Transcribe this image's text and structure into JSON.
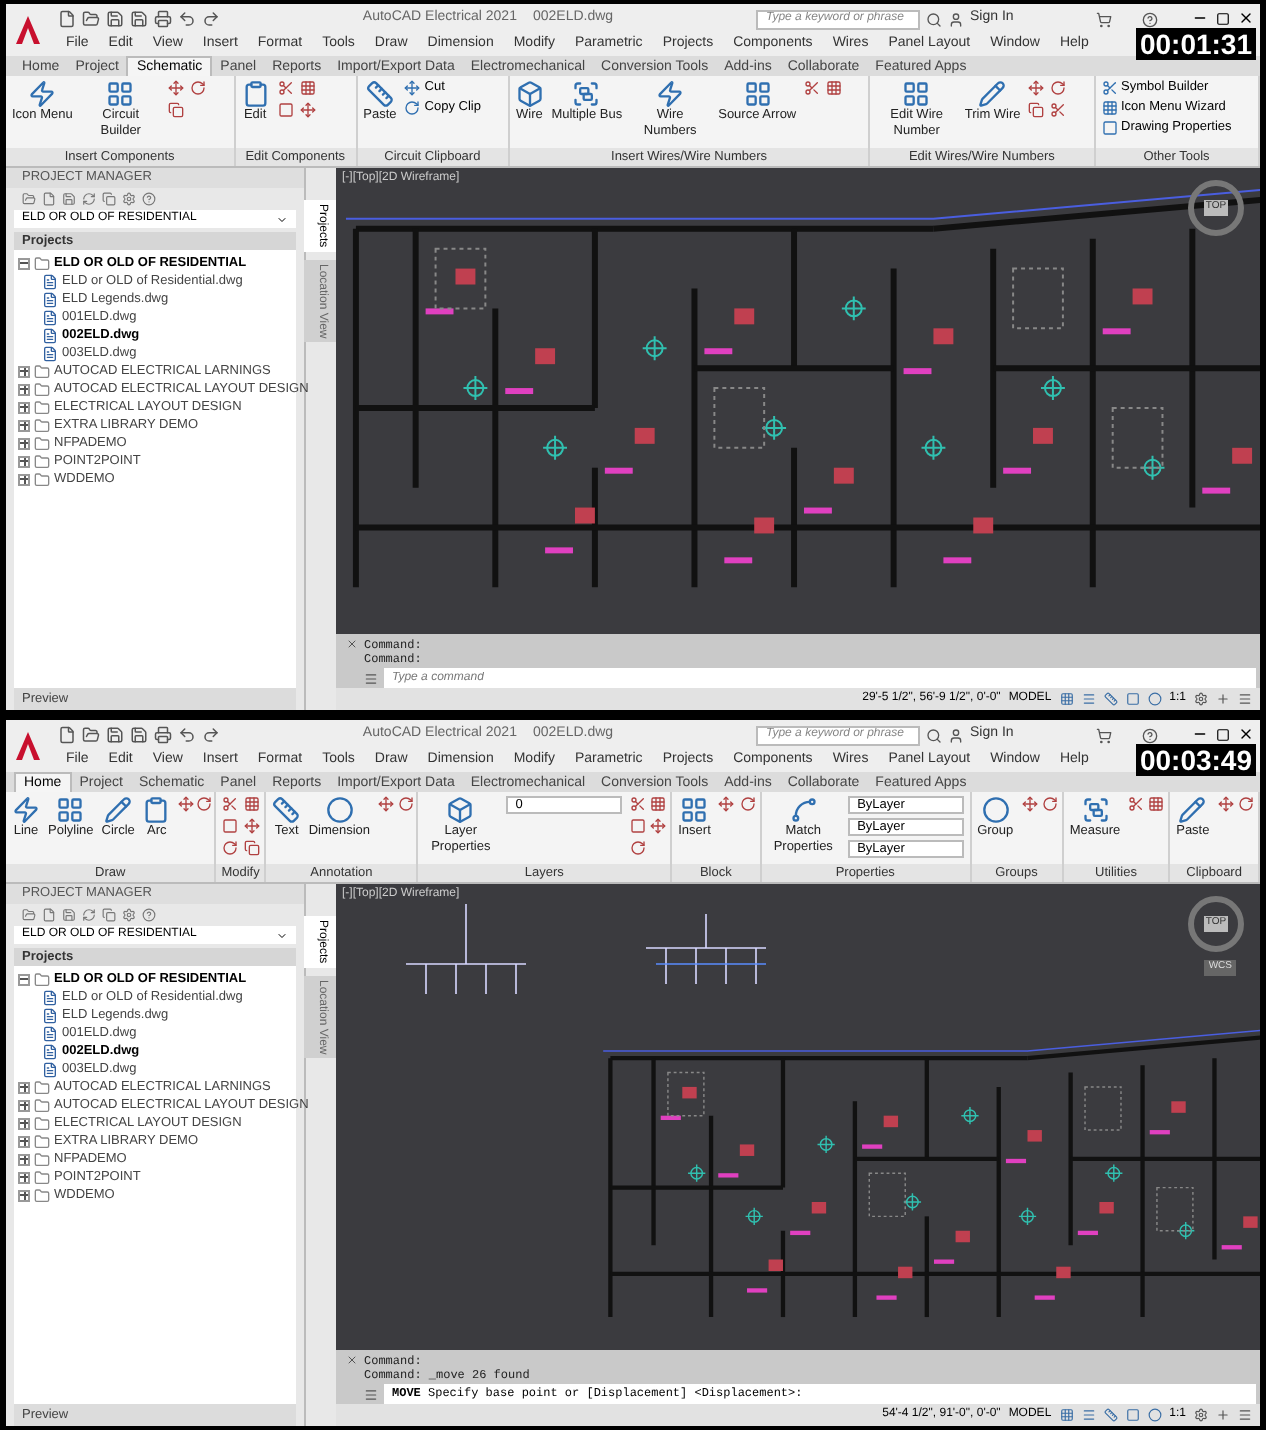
{
  "frames": [
    {
      "timestamp": "00:01:31",
      "title": {
        "app": "AutoCAD Electrical 2021",
        "file": "002ELD.dwg"
      },
      "search": {
        "placeholder": "Type a keyword or phrase"
      },
      "sign_in": "Sign In",
      "menu": [
        "File",
        "Edit",
        "View",
        "Insert",
        "Format",
        "Tools",
        "Draw",
        "Dimension",
        "Modify",
        "Parametric",
        "Projects",
        "Components",
        "Wires",
        "Panel Layout",
        "Window",
        "Help"
      ],
      "tabs": [
        {
          "label": "Home",
          "selected": false
        },
        {
          "label": "Project",
          "selected": false
        },
        {
          "label": "Schematic",
          "selected": true
        },
        {
          "label": "Panel",
          "selected": false
        },
        {
          "label": "Reports",
          "selected": false
        },
        {
          "label": "Import/Export Data",
          "selected": false
        },
        {
          "label": "Electromechanical",
          "selected": false
        },
        {
          "label": "Conversion Tools",
          "selected": false
        },
        {
          "label": "Add-ins",
          "selected": false
        },
        {
          "label": "Collaborate",
          "selected": false
        },
        {
          "label": "Featured Apps",
          "selected": false
        }
      ],
      "ribbon": [
        {
          "title": "Insert Components",
          "tools": [
            "Icon Menu",
            "Circuit Builder"
          ]
        },
        {
          "title": "Edit Components",
          "tools": [
            "Edit"
          ]
        },
        {
          "title": "Circuit Clipboard",
          "tools": [
            "Paste"
          ],
          "side": [
            "Cut",
            "Copy Clip"
          ]
        },
        {
          "title": "Insert Wires/Wire Numbers",
          "tools": [
            "Wire",
            "Multiple Bus",
            "Wire Numbers",
            "Source Arrow"
          ]
        },
        {
          "title": "Edit Wires/Wire Numbers",
          "tools": [
            "Edit Wire Number",
            "Trim Wire"
          ]
        },
        {
          "title": "Other Tools",
          "side": [
            "Symbol Builder",
            "Icon Menu  Wizard",
            "Drawing  Properties"
          ]
        }
      ],
      "project_manager": {
        "title": "PROJECT MANAGER",
        "selector": "ELD OR OLD OF RESIDENTIAL",
        "header": "Projects",
        "preview": "Preview",
        "side_tabs": [
          "Projects",
          "Location View"
        ],
        "tree": [
          {
            "label": "ELD OR OLD OF RESIDENTIAL",
            "selected": true,
            "expanded": true,
            "children": [
              {
                "label": "ELD or OLD of Residential.dwg",
                "selected": false
              },
              {
                "label": "ELD Legends.dwg",
                "selected": false
              },
              {
                "label": "001ELD.dwg",
                "selected": false
              },
              {
                "label": "002ELD.dwg",
                "selected": true
              },
              {
                "label": "003ELD.dwg",
                "selected": false
              }
            ]
          },
          {
            "label": "AUTOCAD ELECTRICAL LARNINGS",
            "selected": false,
            "expanded": false
          },
          {
            "label": "AUTOCAD ELECTRICAL LAYOUT DESIGN",
            "selected": false,
            "expanded": false
          },
          {
            "label": "ELECTRICAL LAYOUT DESIGN",
            "selected": false,
            "expanded": false
          },
          {
            "label": "EXTRA LIBRARY DEMO",
            "selected": false,
            "expanded": false
          },
          {
            "label": "NFPADEMO",
            "selected": false,
            "expanded": false
          },
          {
            "label": "POINT2POINT",
            "selected": false,
            "expanded": false
          },
          {
            "label": "WDDEMO",
            "selected": false,
            "expanded": false
          }
        ]
      },
      "viewport": {
        "label": "[-][Top][2D Wireframe]",
        "kind": "plan",
        "viewcube": "TOP"
      },
      "command": {
        "history": [
          "Command:",
          "Command:"
        ],
        "prompt": {
          "placeholder": "Type a command"
        }
      },
      "status": {
        "coordinates": "29'-5 1/2\", 56'-9 1/2\", 0'-0\"",
        "space": "MODEL",
        "scale": "1:1"
      }
    },
    {
      "timestamp": "00:03:49",
      "title": {
        "app": "AutoCAD Electrical 2021",
        "file": "002ELD.dwg"
      },
      "search": {
        "placeholder": "Type a keyword or phrase"
      },
      "sign_in": "Sign In",
      "menu": [
        "File",
        "Edit",
        "View",
        "Insert",
        "Format",
        "Tools",
        "Draw",
        "Dimension",
        "Modify",
        "Parametric",
        "Projects",
        "Components",
        "Wires",
        "Panel Layout",
        "Window",
        "Help"
      ],
      "tabs": [
        {
          "label": "Home",
          "selected": true
        },
        {
          "label": "Project",
          "selected": false
        },
        {
          "label": "Schematic",
          "selected": false
        },
        {
          "label": "Panel",
          "selected": false
        },
        {
          "label": "Reports",
          "selected": false
        },
        {
          "label": "Import/Export Data",
          "selected": false
        },
        {
          "label": "Electromechanical",
          "selected": false
        },
        {
          "label": "Conversion Tools",
          "selected": false
        },
        {
          "label": "Add-ins",
          "selected": false
        },
        {
          "label": "Collaborate",
          "selected": false
        },
        {
          "label": "Featured Apps",
          "selected": false
        }
      ],
      "ribbon": [
        {
          "title": "Draw",
          "tools": [
            "Line",
            "Polyline",
            "Circle",
            "Arc"
          ]
        },
        {
          "title": "Modify"
        },
        {
          "title": "Annotation",
          "tools": [
            "Text",
            "Dimension"
          ]
        },
        {
          "title": "Layers",
          "tools": [
            "Layer Properties"
          ],
          "dropdowns": [
            "0"
          ]
        },
        {
          "title": "Block",
          "tools": [
            "Insert"
          ]
        },
        {
          "title": "Properties",
          "tools": [
            "Match Properties"
          ],
          "dropdowns": [
            "ByLayer",
            "ByLayer",
            "ByLayer"
          ]
        },
        {
          "title": "Groups",
          "tools": [
            "Group"
          ]
        },
        {
          "title": "Utilities",
          "tools": [
            "Measure"
          ]
        },
        {
          "title": "Clipboard",
          "tools": [
            "Paste"
          ]
        }
      ],
      "project_manager": {
        "title": "PROJECT MANAGER",
        "selector": "ELD OR OLD OF RESIDENTIAL",
        "header": "Projects",
        "preview": "Preview",
        "side_tabs": [
          "Projects",
          "Location View"
        ],
        "tree": [
          {
            "label": "ELD OR OLD OF RESIDENTIAL",
            "selected": true,
            "expanded": true,
            "children": [
              {
                "label": "ELD or OLD of Residential.dwg",
                "selected": false
              },
              {
                "label": "ELD Legends.dwg",
                "selected": false
              },
              {
                "label": "001ELD.dwg",
                "selected": false
              },
              {
                "label": "002ELD.dwg",
                "selected": true
              },
              {
                "label": "003ELD.dwg",
                "selected": false
              }
            ]
          },
          {
            "label": "AUTOCAD ELECTRICAL LARNINGS",
            "selected": false,
            "expanded": false
          },
          {
            "label": "AUTOCAD ELECTRICAL LAYOUT DESIGN",
            "selected": false,
            "expanded": false
          },
          {
            "label": "ELECTRICAL LAYOUT DESIGN",
            "selected": false,
            "expanded": false
          },
          {
            "label": "EXTRA LIBRARY DEMO",
            "selected": false,
            "expanded": false
          },
          {
            "label": "NFPADEMO",
            "selected": false,
            "expanded": false
          },
          {
            "label": "POINT2POINT",
            "selected": false,
            "expanded": false
          },
          {
            "label": "WDDEMO",
            "selected": false,
            "expanded": false
          }
        ]
      },
      "viewport": {
        "label": "[-][Top][2D Wireframe]",
        "kind": "schematic_and_plan",
        "viewcube": "TOP",
        "ucs": "WCS"
      },
      "command": {
        "history": [
          "Command:",
          "Command: _move 26 found"
        ],
        "prompt": {
          "value": "**MOVE** Specify base point or [Displacement] <Displacement>:"
        }
      },
      "status": {
        "coordinates": "54'-4 1/2\", 91'-0\", 0'-0\"",
        "space": "MODEL",
        "scale": "1:1"
      }
    }
  ]
}
